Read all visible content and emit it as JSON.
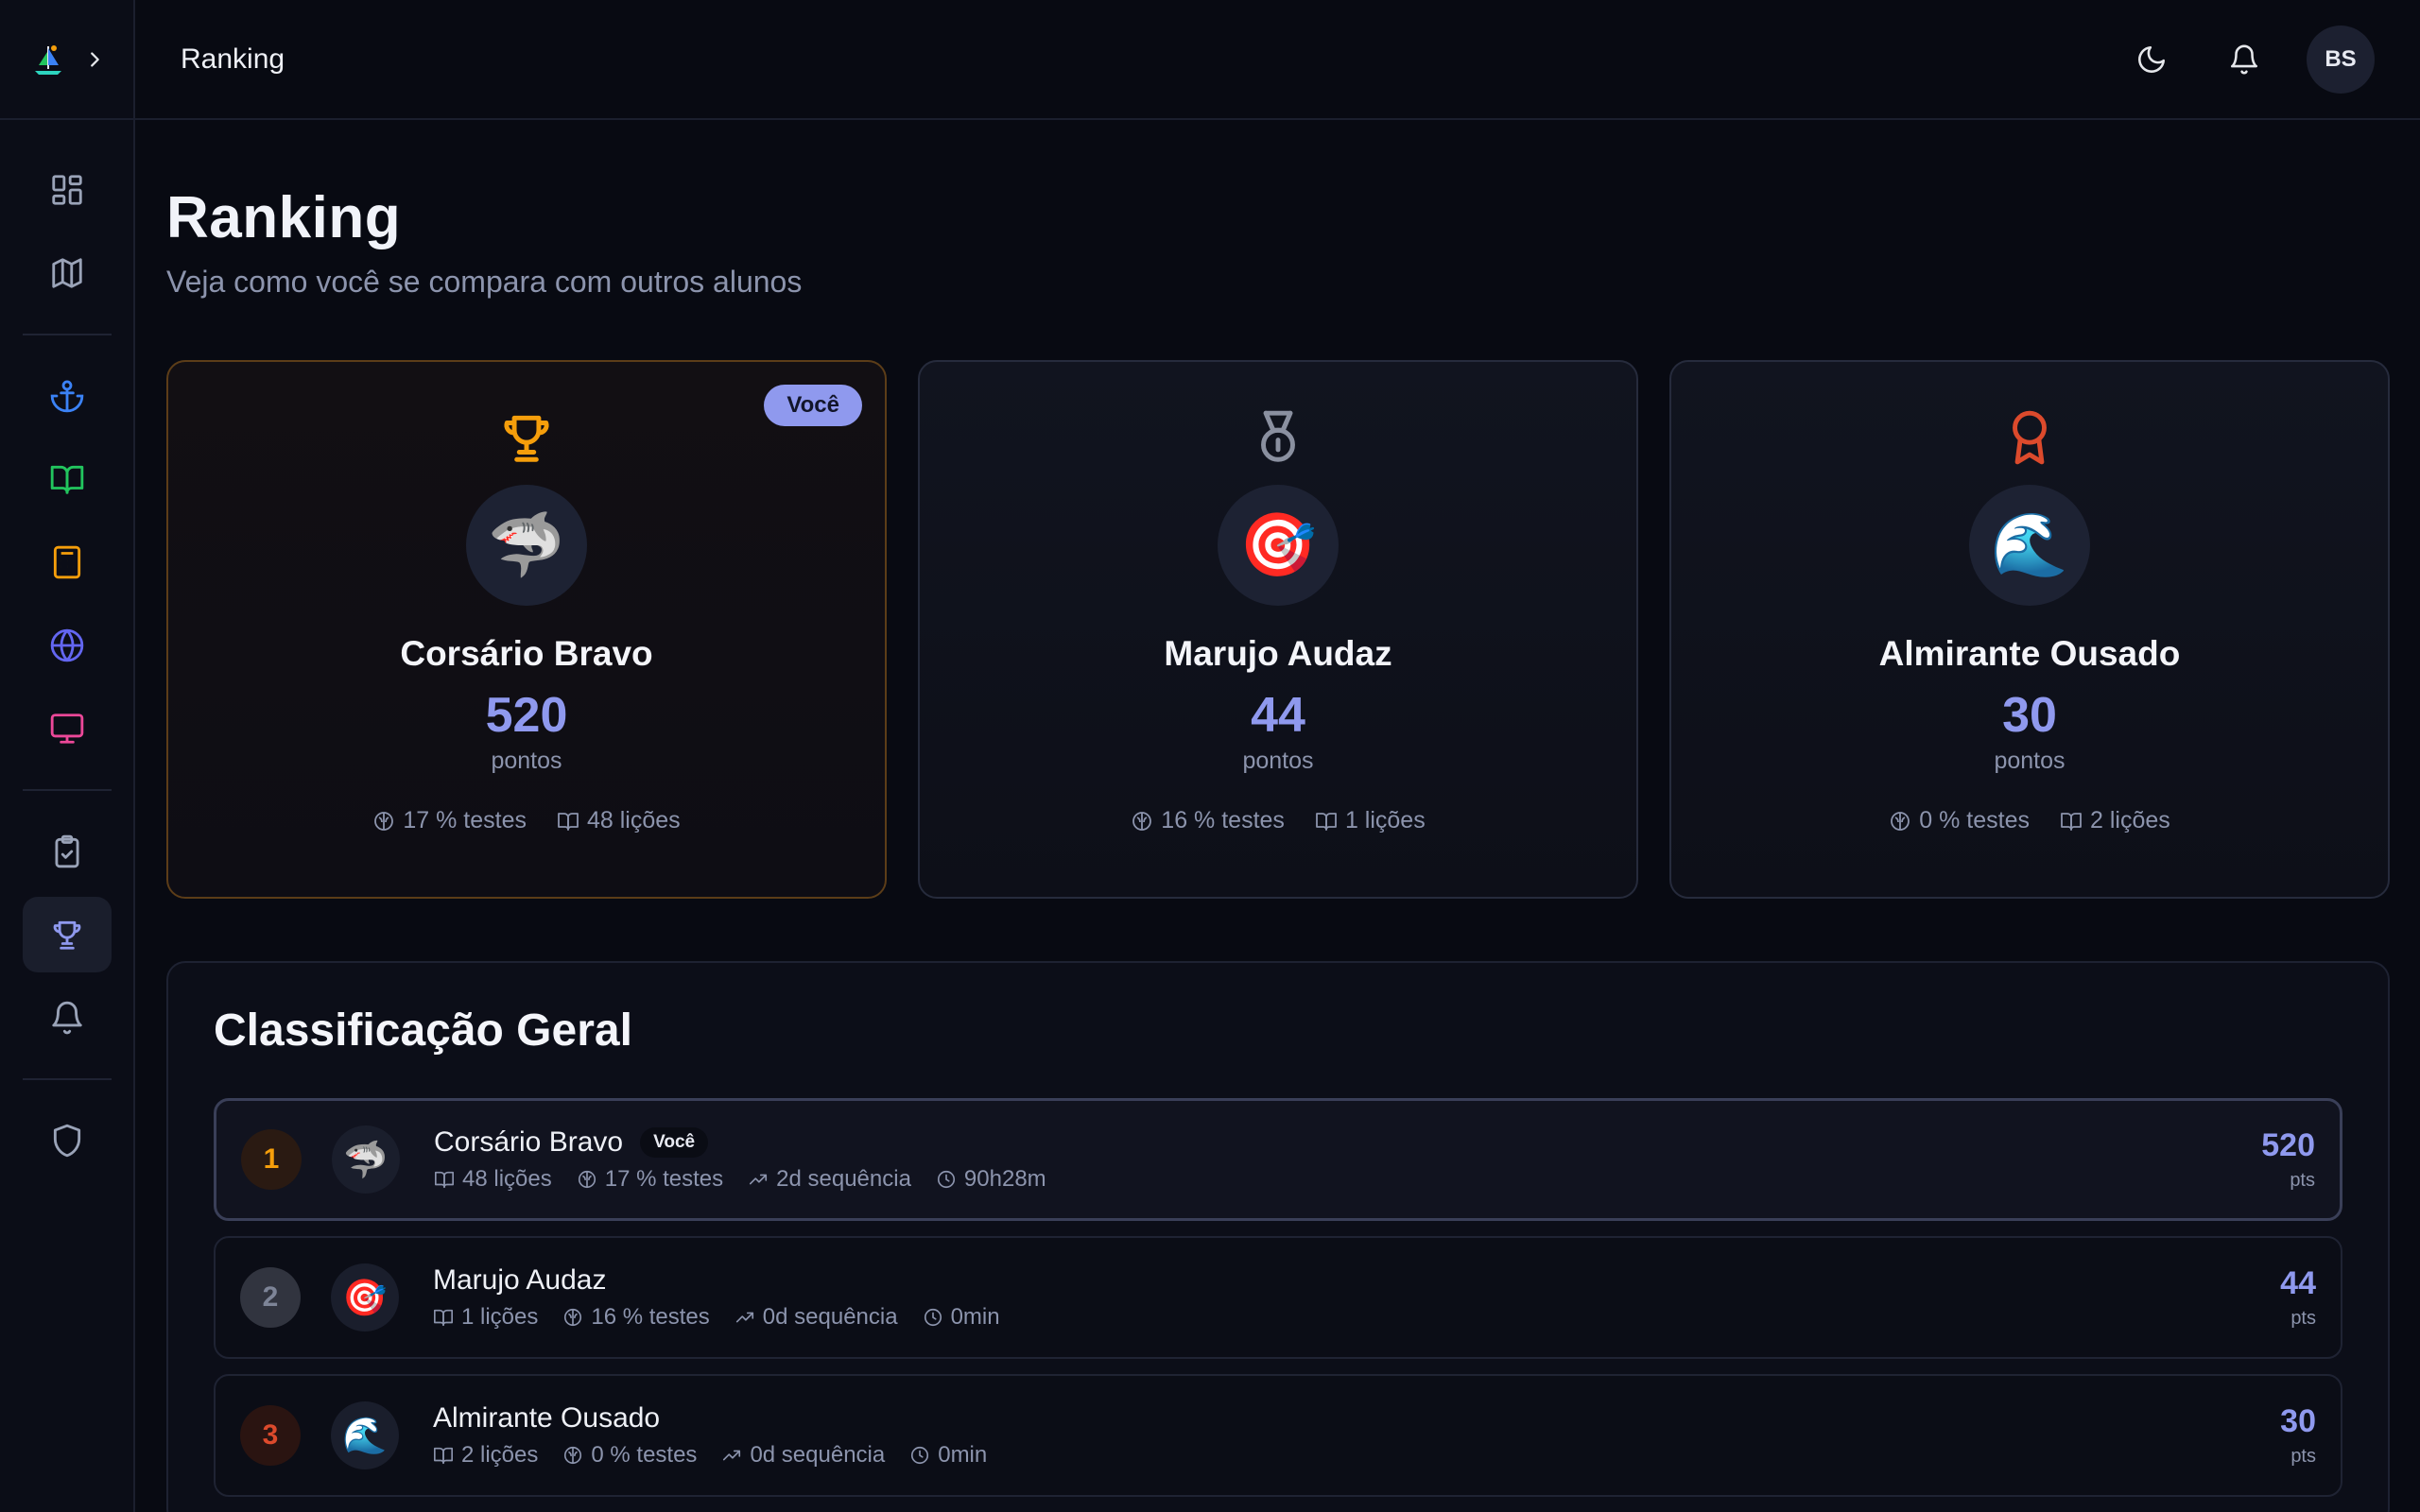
{
  "app": {
    "topbar_title": "Ranking",
    "user_initials": "BS"
  },
  "sidebar": {
    "items": [
      {
        "icon": "dashboard-icon",
        "color": "#9aa3b8"
      },
      {
        "icon": "map-icon",
        "color": "#9aa3b8"
      },
      {
        "icon": "anchor-icon",
        "color": "#3b82f6"
      },
      {
        "icon": "book-icon",
        "color": "#22c55e"
      },
      {
        "icon": "calculator-icon",
        "color": "#f59e0b"
      },
      {
        "icon": "globe-icon",
        "color": "#6366f1"
      },
      {
        "icon": "monitor-icon",
        "color": "#ec4899"
      },
      {
        "icon": "clipboard-check-icon",
        "color": "#9aa3b8"
      },
      {
        "icon": "trophy-icon",
        "color": "#8f99ee",
        "active": true
      },
      {
        "icon": "bell-icon",
        "color": "#9aa3b8"
      },
      {
        "icon": "shield-icon",
        "color": "#9aa3b8"
      }
    ]
  },
  "page": {
    "title": "Ranking",
    "subtitle": "Veja como você se compara com outros alunos"
  },
  "colors": {
    "accent": "#8f99ee",
    "gold": "#f59e0b",
    "silver": "#8a90a0",
    "bronze": "#dc4a2c"
  },
  "podium": [
    {
      "place": 1,
      "medal_icon": "trophy-icon",
      "badge": "Você",
      "avatar": "🦈",
      "name": "Corsário Bravo",
      "score": "520",
      "unit": "pontos",
      "tests": "17 % testes",
      "lessons": "48 lições"
    },
    {
      "place": 2,
      "medal_icon": "medal-icon",
      "badge": "",
      "avatar": "🎯",
      "name": "Marujo Audaz",
      "score": "44",
      "unit": "pontos",
      "tests": "16 % testes",
      "lessons": "1 lições"
    },
    {
      "place": 3,
      "medal_icon": "award-icon",
      "badge": "",
      "avatar": "🌊",
      "name": "Almirante Ousado",
      "score": "30",
      "unit": "pontos",
      "tests": "0 % testes",
      "lessons": "2 lições"
    }
  ],
  "board": {
    "title": "Classificação Geral",
    "rows": [
      {
        "rank": "1",
        "avatar": "🦈",
        "name": "Corsário Bravo",
        "badge": "Você",
        "lessons": "48 lições",
        "tests": "17 % testes",
        "streak": "2d sequência",
        "time": "90h28m",
        "score": "520",
        "unit": "pts"
      },
      {
        "rank": "2",
        "avatar": "🎯",
        "name": "Marujo Audaz",
        "badge": "",
        "lessons": "1 lições",
        "tests": "16 % testes",
        "streak": "0d sequência",
        "time": "0min",
        "score": "44",
        "unit": "pts"
      },
      {
        "rank": "3",
        "avatar": "🌊",
        "name": "Almirante Ousado",
        "badge": "",
        "lessons": "2 lições",
        "tests": "0 % testes",
        "streak": "0d sequência",
        "time": "0min",
        "score": "30",
        "unit": "pts"
      }
    ]
  }
}
